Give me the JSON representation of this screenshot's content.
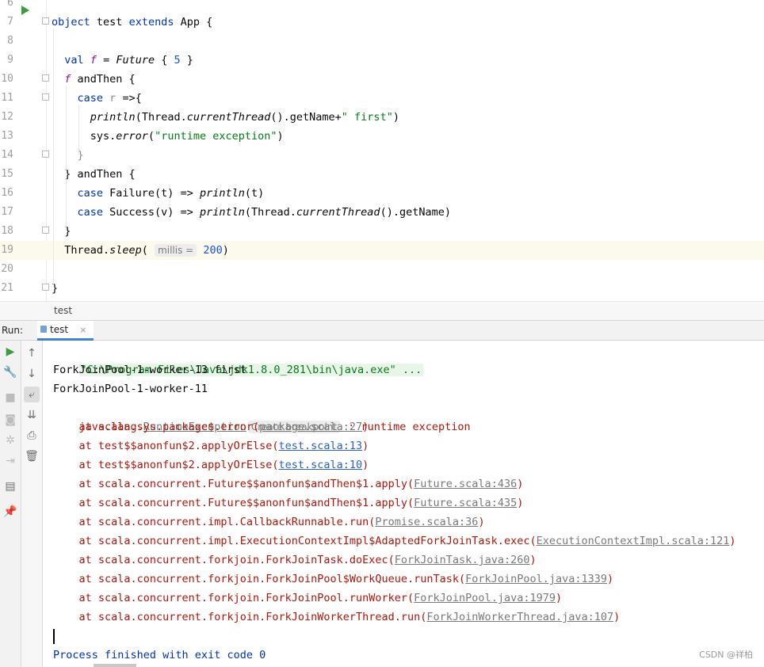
{
  "editor": {
    "lines": [
      {
        "num": "6",
        "segments": []
      },
      {
        "num": "7",
        "segments": [
          {
            "t": "object",
            "c": "kw"
          },
          {
            "t": " test "
          },
          {
            "t": "extends",
            "c": "kw"
          },
          {
            "t": " App {"
          }
        ]
      },
      {
        "num": "8",
        "segments": []
      },
      {
        "num": "9",
        "segments": [
          {
            "t": "  "
          },
          {
            "t": "val",
            "c": "kw"
          },
          {
            "t": " "
          },
          {
            "t": "f",
            "c": "fvar"
          },
          {
            "t": " = "
          },
          {
            "t": "Future",
            "c": "ital"
          },
          {
            "t": " { "
          },
          {
            "t": "5",
            "c": "num"
          },
          {
            "t": " }"
          }
        ]
      },
      {
        "num": "10",
        "segments": [
          {
            "t": "  "
          },
          {
            "t": "f",
            "c": "fvar"
          },
          {
            "t": " andThen {"
          }
        ]
      },
      {
        "num": "11",
        "segments": [
          {
            "t": "    "
          },
          {
            "t": "case",
            "c": "kw"
          },
          {
            "t": " "
          },
          {
            "t": "r",
            "c": "param"
          },
          {
            "t": " =>{"
          }
        ]
      },
      {
        "num": "12",
        "segments": [
          {
            "t": "      "
          },
          {
            "t": "println",
            "c": "ital"
          },
          {
            "t": "(Thread."
          },
          {
            "t": "currentThread",
            "c": "ital"
          },
          {
            "t": "().getName+"
          },
          {
            "t": "\" first\"",
            "c": "str"
          },
          {
            "t": ")"
          }
        ]
      },
      {
        "num": "13",
        "segments": [
          {
            "t": "      sys."
          },
          {
            "t": "error",
            "c": "ital"
          },
          {
            "t": "("
          },
          {
            "t": "\"runtime exception\"",
            "c": "str"
          },
          {
            "t": ")"
          }
        ]
      },
      {
        "num": "14",
        "segments": [
          {
            "t": "    "
          },
          {
            "t": "}",
            "c": "param"
          }
        ]
      },
      {
        "num": "15",
        "segments": [
          {
            "t": "  } andThen {"
          }
        ]
      },
      {
        "num": "16",
        "segments": [
          {
            "t": "    "
          },
          {
            "t": "case",
            "c": "kw"
          },
          {
            "t": " Failure(t) => "
          },
          {
            "t": "println",
            "c": "ital"
          },
          {
            "t": "(t)"
          }
        ]
      },
      {
        "num": "17",
        "segments": [
          {
            "t": "    "
          },
          {
            "t": "case",
            "c": "kw"
          },
          {
            "t": " Success(v) => "
          },
          {
            "t": "println",
            "c": "ital"
          },
          {
            "t": "(Thread."
          },
          {
            "t": "currentThread",
            "c": "ital"
          },
          {
            "t": "().getName)"
          }
        ]
      },
      {
        "num": "18",
        "segments": [
          {
            "t": "  }"
          }
        ]
      },
      {
        "num": "19",
        "segments": [
          {
            "t": "  Thread."
          },
          {
            "t": "sleep",
            "c": "ital"
          },
          {
            "t": "( "
          },
          {
            "t": "millis =",
            "c": "hint"
          },
          {
            "t": " "
          },
          {
            "t": "200",
            "c": "num"
          },
          {
            "t": ")"
          }
        ],
        "current": true
      },
      {
        "num": "20",
        "segments": []
      },
      {
        "num": "21",
        "segments": [
          {
            "t": "}"
          }
        ]
      }
    ]
  },
  "breadcrumb": "test",
  "run_panel": {
    "label": "Run:",
    "tab_label": "test",
    "tab_close": "×"
  },
  "toolbar_icons": {
    "left": [
      "rerun-icon",
      "wrench-icon",
      "stop-icon",
      "camera-icon",
      "exit-icon",
      "login-icon",
      "layout-icon",
      "pin-icon"
    ],
    "right": [
      "up-arrow-icon",
      "down-arrow-icon",
      "soft-wrap-icon",
      "scroll-to-end-icon",
      "print-icon",
      "trash-icon"
    ]
  },
  "console": {
    "command": "\"C:\\Program Files\\Java\\jdk1.8.0_281\\bin\\java.exe\" ...",
    "out1": "ForkJoinPool-1-worker-13 first",
    "out2": "ForkJoinPool-1-worker-11",
    "exc_prefix": "java.lang.",
    "exc_class": "RuntimeException",
    "exc_hint": "Create breakpoint",
    "exc_msg": " : runtime exception",
    "stack": [
      {
        "pre": "    at scala.sys.package$.error(",
        "link": "package.scala:27",
        "src": false
      },
      {
        "pre": "    at test$$anonfun$2.applyOrElse(",
        "link": "test.scala:13",
        "src": true
      },
      {
        "pre": "    at test$$anonfun$2.applyOrElse(",
        "link": "test.scala:10",
        "src": true
      },
      {
        "pre": "    at scala.concurrent.Future$$anonfun$andThen$1.apply(",
        "link": "Future.scala:436",
        "src": false
      },
      {
        "pre": "    at scala.concurrent.Future$$anonfun$andThen$1.apply(",
        "link": "Future.scala:435",
        "src": false
      },
      {
        "pre": "    at scala.concurrent.impl.CallbackRunnable.run(",
        "link": "Promise.scala:36",
        "src": false
      },
      {
        "pre": "    at scala.concurrent.impl.ExecutionContextImpl$AdaptedForkJoinTask.exec(",
        "link": "ExecutionContextImpl.scala:121",
        "src": false
      },
      {
        "pre": "    at scala.concurrent.forkjoin.ForkJoinTask.doExec(",
        "link": "ForkJoinTask.java:260",
        "src": false
      },
      {
        "pre": "    at scala.concurrent.forkjoin.ForkJoinPool$WorkQueue.runTask(",
        "link": "ForkJoinPool.java:1339",
        "src": false
      },
      {
        "pre": "    at scala.concurrent.forkjoin.ForkJoinPool.runWorker(",
        "link": "ForkJoinPool.java:1979",
        "src": false
      },
      {
        "pre": "    at scala.concurrent.forkjoin.ForkJoinWorkerThread.run(",
        "link": "ForkJoinWorkerThread.java:107",
        "src": false
      }
    ],
    "exit_msg": "Process finished with exit code 0"
  },
  "watermark": "CSDN @祥柏"
}
